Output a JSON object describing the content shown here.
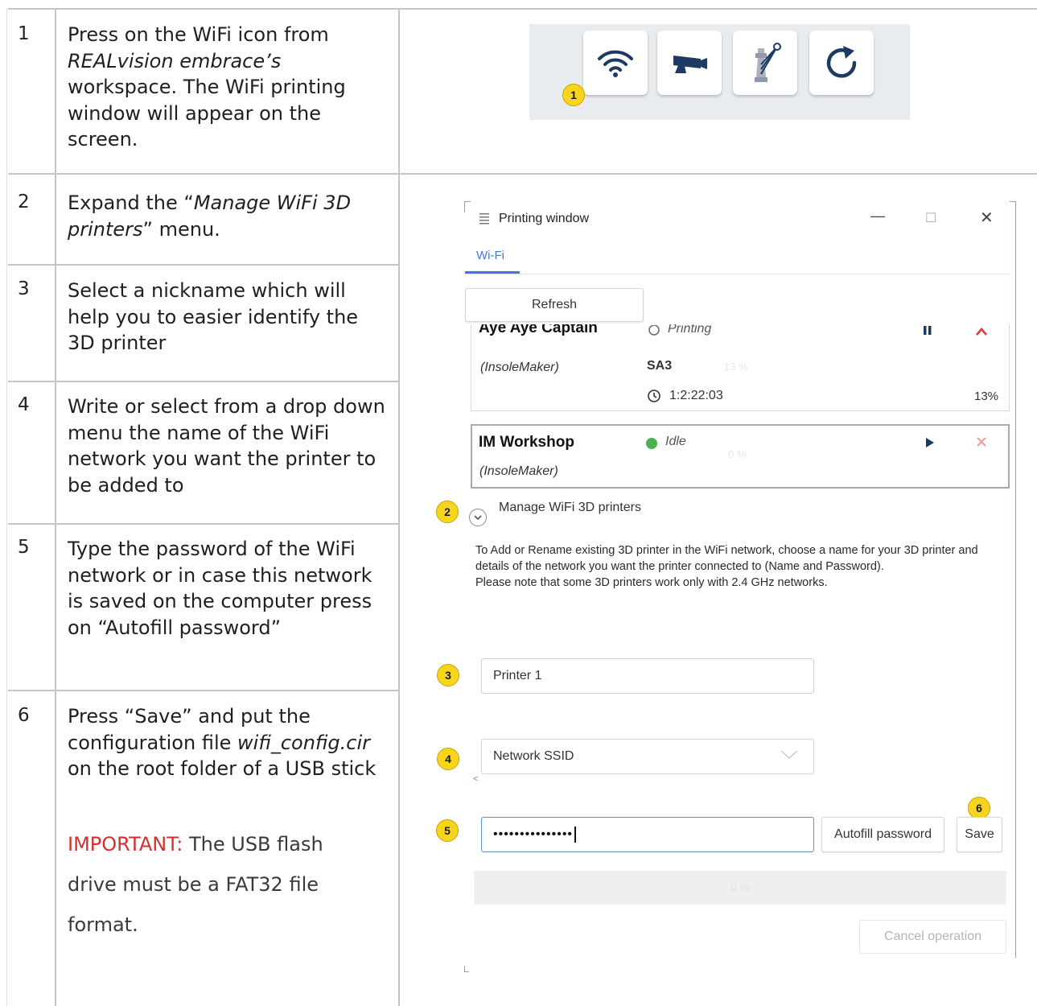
{
  "steps": [
    {
      "number": "1",
      "text_parts": [
        "Press on the WiFi icon from ",
        "REALvision embrace’s",
        " workspace. The WiFi printing window will appear on the screen."
      ]
    },
    {
      "number": "2",
      "text_parts": [
        "Expand the “",
        "Manage WiFi 3D printers",
        "” menu."
      ]
    },
    {
      "number": "3",
      "text": "Select a nickname which will help you to easier identify the 3D printer"
    },
    {
      "number": "4",
      "text": "Write or select from a drop down menu the name of the WiFi network you want the printer to be added to"
    },
    {
      "number": "5",
      "text": "Type the password of the WiFi network or in case this network is saved on the computer press on “Autofill password”"
    },
    {
      "number": "6",
      "text_parts": [
        "Press “Save” and put the configuration file ",
        "wifi_config.cir",
        " on the root folder of a USB stick"
      ],
      "important_label": "IMPORTANT:",
      "important_line1": " The USB flash",
      "important_line2": "drive must be a FAT32 file",
      "important_line3": "format."
    }
  ],
  "toolbar": {
    "icons": [
      "wifi-icon",
      "camera-icon",
      "tower-icon",
      "refresh-icon"
    ]
  },
  "markers": [
    "1",
    "2",
    "3",
    "4",
    "5",
    "6"
  ],
  "window": {
    "title": "Printing window",
    "minimize": "—",
    "maximize": "☐",
    "close": "✕",
    "tab": "Wi-Fi",
    "refresh_label": "Refresh",
    "printers": [
      {
        "name": "Aye Aye Captain",
        "type": "(InsoleMaker)",
        "status": "Printing",
        "model": "SA3",
        "ghost_percent": "13 %",
        "time": "1:2:22:03",
        "progress": "13%",
        "status_color": "#555555"
      },
      {
        "name": "IM Workshop",
        "type": "(InsoleMaker)",
        "status": "Idle",
        "ghost_percent": "0 %",
        "status_color": "#4caf50"
      }
    ],
    "manage_label": "Manage WiFi 3D printers",
    "description_1": "To Add or Rename existing 3D printer in the WiFi network, choose a name for your 3D printer and details of the network you want the printer connected to (Name and Password).",
    "description_2": "Please note that some 3D printers work only with 2.4 GHz networks.",
    "nickname_value": "Printer 1",
    "ssid_placeholder": "Network SSID",
    "password_value": "•••••••••••••••",
    "autofill_label": "Autofill password",
    "save_label": "Save",
    "progress_text": "0 %",
    "cancel_label": "Cancel operation",
    "small_glyph": "<"
  },
  "colors": {
    "important": "#d32f2f",
    "accent": "#3b78e7",
    "marker": "#f7d51e",
    "stop": "#e53935"
  }
}
